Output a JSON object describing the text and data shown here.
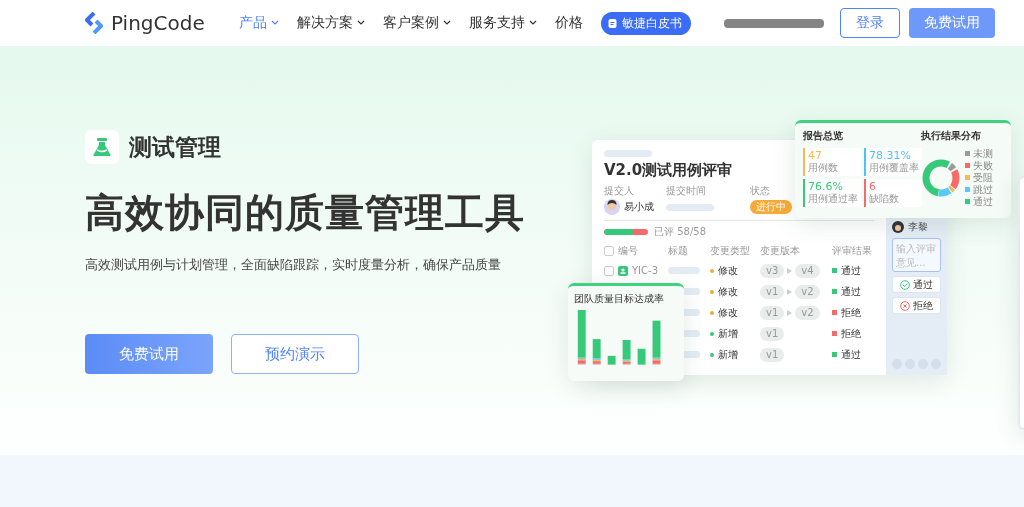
{
  "nav": {
    "logo": "PingCode",
    "items": [
      {
        "label": "产品",
        "selected": true,
        "dropdown": true
      },
      {
        "label": "解决方案",
        "selected": false,
        "dropdown": true
      },
      {
        "label": "客户案例",
        "selected": false,
        "dropdown": true
      },
      {
        "label": "服务支持",
        "selected": false,
        "dropdown": true
      },
      {
        "label": "价格",
        "selected": false,
        "dropdown": false
      }
    ],
    "badge": "敏捷白皮书",
    "login": "登录",
    "trial": "免费试用"
  },
  "hero": {
    "product": "测试管理",
    "headline": "高效协同的质量管理工具",
    "subtitle": "高效测试用例与计划管理，全面缺陷跟踪，实时度量分析，确保产品质量",
    "primary_button": "免费试用",
    "secondary_button": "预约演示"
  },
  "review_card": {
    "title": "V2.0测试用例评审",
    "meta_labels": [
      "提交人",
      "提交时间",
      "状态"
    ],
    "submitter": "易小成",
    "status": "进行中",
    "progress": {
      "level": 0.65,
      "text": "已评 58/58"
    },
    "columns": [
      "编号",
      "标题",
      "变更类型",
      "变更版本",
      "评审结果"
    ],
    "header_checkbox": {
      "checked": false
    },
    "rows": [
      {
        "checkbox": {
          "checked": false
        },
        "id": "YIC-3",
        "change_type": {
          "label": "修改",
          "color": "#f5a73b"
        },
        "from": "v3",
        "to": "v4",
        "result": {
          "label": "通过",
          "color": "#36c97a"
        }
      },
      {
        "change_type": {
          "label": "修改",
          "color": "#f5a73b"
        },
        "from": "v1",
        "to": "v2",
        "result": {
          "label": "通过",
          "color": "#36c97a"
        }
      },
      {
        "change_type": {
          "label": "修改",
          "color": "#f5a73b"
        },
        "from": "v1",
        "to": "v2",
        "result": {
          "label": "拒绝",
          "color": "#f76a6a"
        }
      },
      {
        "change_type": {
          "label": "新增",
          "color": "#36c97a"
        },
        "from": "v1",
        "result": {
          "label": "拒绝",
          "color": "#f76a6a"
        }
      },
      {
        "change_type": {
          "label": "新增",
          "color": "#36c97a"
        },
        "from": "v1",
        "result": {
          "label": "通过",
          "color": "#36c97a"
        }
      }
    ],
    "reviewer": "李黎",
    "comment_placeholder": "输入评审意见...",
    "approve": "通过",
    "reject": "拒绝"
  },
  "report_card": {
    "title": "报告总览",
    "stats": [
      {
        "value": "47",
        "label": "用例数",
        "color": "#f7b955"
      },
      {
        "value": "78.31%",
        "label": "用例覆盖率",
        "color": "#4cc3f5"
      },
      {
        "value": "76.6%",
        "label": "用例通过率",
        "color": "#36c97a"
      },
      {
        "value": "6",
        "label": "缺陷数",
        "color": "#f76a6a"
      }
    ],
    "distribution_title": "执行结果分布",
    "legend": [
      {
        "label": "未测",
        "color": "#9a9a9a"
      },
      {
        "label": "失败",
        "color": "#f76a6a"
      },
      {
        "label": "受阻",
        "color": "#f7b955"
      },
      {
        "label": "跳过",
        "color": "#5cc8f7"
      },
      {
        "label": "通过",
        "color": "#36c97a"
      }
    ]
  },
  "chart_card": {
    "title": "团队质量目标达成率"
  }
}
